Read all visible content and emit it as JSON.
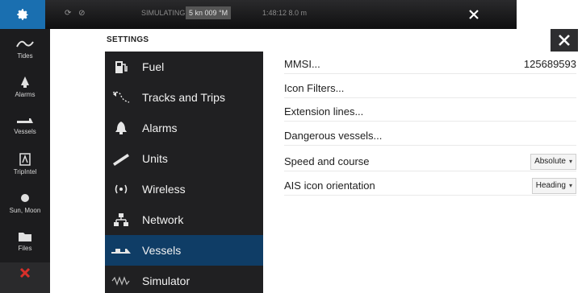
{
  "topbar": {
    "status_icons": "⟳ ⊘",
    "sim_label": "SIMULATING",
    "speed_tag": "5 kn  009 °M",
    "time": "1:48:12  8.0 m"
  },
  "rail": {
    "items": [
      {
        "label": "Tides",
        "icon": "tides-icon"
      },
      {
        "label": "Alarms",
        "icon": "alarm-icon"
      },
      {
        "label": "Vessels",
        "icon": "vessel-icon"
      },
      {
        "label": "TripIntel",
        "icon": "tripintel-icon"
      },
      {
        "label": "Sun, Moon",
        "icon": "sun-moon-icon"
      },
      {
        "label": "Files",
        "icon": "folder-icon"
      }
    ]
  },
  "settings": {
    "title": "SETTINGS",
    "categories": [
      {
        "label": "Fuel",
        "icon": "fuel-icon"
      },
      {
        "label": "Tracks and Trips",
        "icon": "tracks-icon"
      },
      {
        "label": "Alarms",
        "icon": "alarm-bell-icon"
      },
      {
        "label": "Units",
        "icon": "ruler-icon"
      },
      {
        "label": "Wireless",
        "icon": "wireless-icon"
      },
      {
        "label": "Network",
        "icon": "network-icon"
      },
      {
        "label": "Vessels",
        "icon": "vessels-icon",
        "active": true
      },
      {
        "label": "Simulator",
        "icon": "simulator-icon"
      }
    ],
    "rows": [
      {
        "label": "MMSI...",
        "value": "125689593"
      },
      {
        "label": "Icon Filters..."
      },
      {
        "label": "Extension lines..."
      },
      {
        "label": "Dangerous vessels..."
      },
      {
        "label": "Speed and course",
        "dropdown": "Absolute"
      },
      {
        "label": "AIS icon orientation",
        "dropdown": "Heading"
      }
    ]
  },
  "colors": {
    "accent": "#1a6fb0",
    "active_category": "#0f3d66",
    "panel_dark": "#202022",
    "alert_red": "#d8302a"
  }
}
